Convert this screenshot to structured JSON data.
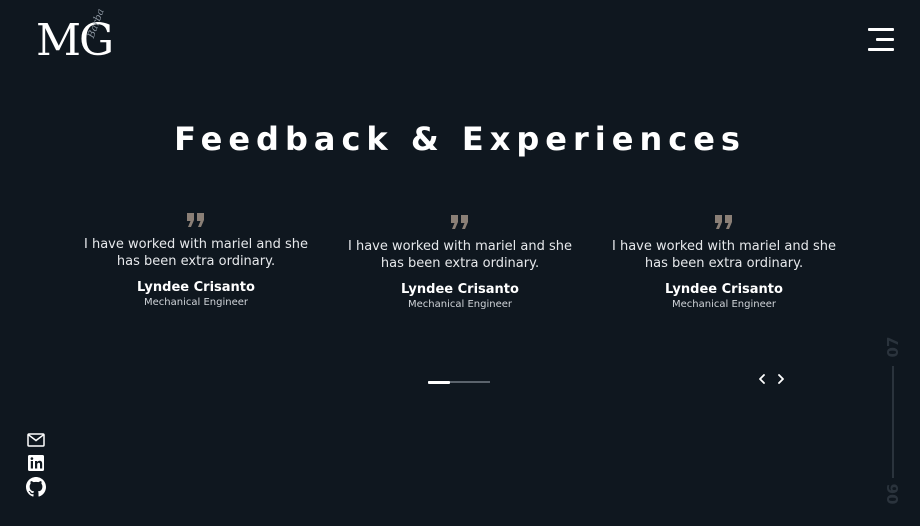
{
  "logo": {
    "letters": "MG",
    "script": "Barba"
  },
  "header": {
    "title": "Feedback & Experiences"
  },
  "testimonials": [
    {
      "quote": "I have worked with mariel and she has been extra ordinary.",
      "name": "Lyndee Crisanto",
      "role": "Mechanical Engineer"
    },
    {
      "quote": "I have worked with mariel and she has been extra ordinary.",
      "name": "Lyndee Crisanto",
      "role": "Mechanical Engineer"
    },
    {
      "quote": "I have worked with mariel and she has been extra ordinary.",
      "name": "Lyndee Crisanto",
      "role": "Mechanical Engineer"
    }
  ],
  "pagination": {
    "active_fraction": 0.35
  },
  "icons": {
    "quote": "quote-icon",
    "menu": "hamburger-menu-icon",
    "prev": "chevron-left-icon",
    "next": "chevron-right-icon",
    "mail": "mail-icon",
    "linkedin": "linkedin-icon",
    "github": "github-icon"
  },
  "section": {
    "next": "07",
    "current": "06"
  },
  "colors": {
    "background": "#0f171f",
    "quote_accent": "#8a7f76",
    "section_indicator": "#2a333c",
    "text": "#ffffff"
  }
}
